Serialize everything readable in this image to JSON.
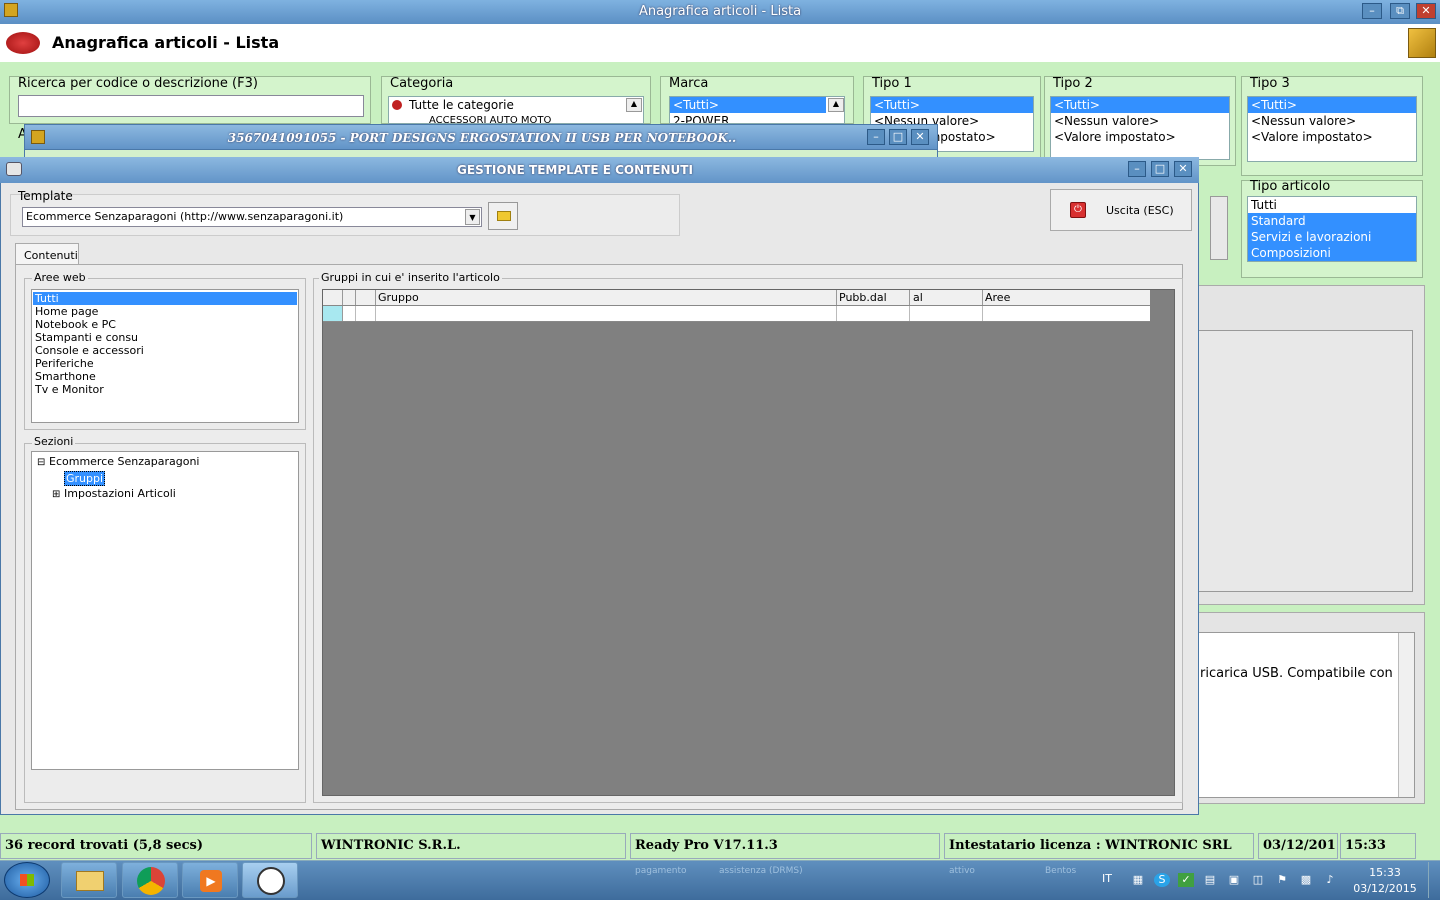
{
  "main": {
    "window_title": "Anagrafica articoli  - Lista",
    "header_title": "Anagrafica articoli  - Lista",
    "search": {
      "label": "Ricerca per codice o descrizione (F3)",
      "value": "",
      "placeholder": ""
    },
    "category": {
      "label": "Categoria",
      "items": [
        "Tutte le categorie",
        "ACCESSORI AUTO MOTO"
      ]
    },
    "marca": {
      "label": "Marca",
      "items": [
        "<Tutti>",
        "2-POWER"
      ]
    },
    "tipo1": {
      "label": "Tipo 1",
      "items": [
        "<Tutti>",
        "<Nessun valore>",
        "<Valore impostato>"
      ]
    },
    "tipo2": {
      "label": "Tipo 2",
      "items": [
        "<Tutti>",
        "<Nessun valore>",
        "<Valore impostato>"
      ]
    },
    "tipo3": {
      "label": "Tipo 3",
      "items": [
        "<Tutti>",
        "<Nessun valore>",
        "<Valore impostato>"
      ]
    },
    "tipo_articolo": {
      "label": "Tipo articolo",
      "items": [
        "Tutti",
        "Standard",
        "Servizi e lavorazioni",
        "Composizioni"
      ]
    },
    "hidden_label": "A",
    "description_fragment": "ricarica USB. Compatibile con"
  },
  "product_window": {
    "title": "3567041091055 - PORT DESIGNS ERGOSTATION II USB PER NOTEBOOK.."
  },
  "dialog": {
    "title": "GESTIONE TEMPLATE E CONTENUTI",
    "template_label": "Template",
    "template_value": "Ecommerce Senzaparagoni  (http://www.senzaparagoni.it)",
    "exit_label": "Uscita (ESC)",
    "tab": "Contenuti",
    "aree_label": "Aree web",
    "aree_items": [
      "Tutti",
      "Home page",
      "Notebook e PC",
      "Stampanti e consu",
      "Console e accessori",
      "Periferiche",
      "Smarthone",
      "Tv e Monitor"
    ],
    "sezioni_label": "Sezioni",
    "tree": {
      "root": "Ecommerce Senzaparagoni",
      "child_selected": "Gruppi",
      "child2": "Impostazioni Articoli"
    },
    "grid_label": "Gruppi in cui e' inserito l'articolo",
    "columns": [
      "Gruppo",
      "Pubb.dal",
      "al",
      "Aree"
    ]
  },
  "statusbar": {
    "records": "36 record trovati (5,8 secs)",
    "company": "WINTRONIC S.R.L.",
    "version": "Ready Pro V17.11.3",
    "license": "Intestatario licenza : WINTRONIC SRL",
    "date": "03/12/201",
    "time": "15:33"
  },
  "taskbar": {
    "lang": "IT",
    "clock_time": "15:33",
    "clock_date": "03/12/2015",
    "bg_text": [
      "pagamento",
      "assistenza (DRMS)",
      "attivo",
      "Bentos"
    ]
  },
  "colors": {
    "selection": "#3390ff",
    "title_bar": "#6a9fd0",
    "background": "#c8f0c0"
  }
}
